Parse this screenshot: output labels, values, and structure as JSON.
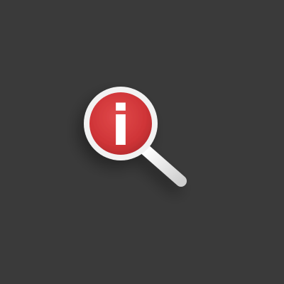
{
  "icon": {
    "name": "magnifier-info-icon",
    "glyph": "i",
    "colors": {
      "background": "#3a3a3a",
      "lens_fill": "#d9383a",
      "lens_ring": "#f2f2f2",
      "handle": "#e8e8e8",
      "glyph": "#ffffff"
    }
  }
}
